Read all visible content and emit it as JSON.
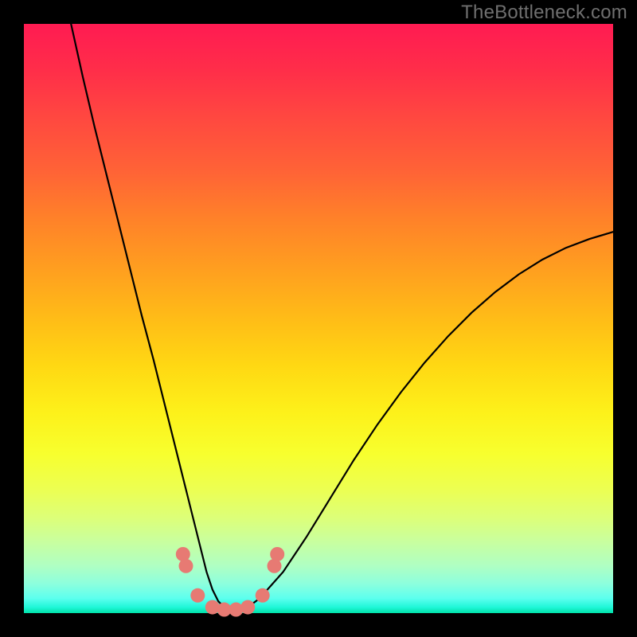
{
  "watermark": "TheBottleneck.com",
  "colors": {
    "frame": "#000000",
    "curve": "#000000",
    "marker_fill": "#e77a73",
    "marker_stroke": "#b94f4a"
  },
  "chart_data": {
    "type": "line",
    "title": "",
    "xlabel": "",
    "ylabel": "",
    "xlim": [
      0,
      100
    ],
    "ylim": [
      0,
      100
    ],
    "grid": false,
    "legend": false,
    "series": [
      {
        "name": "bottleneck-curve",
        "x": [
          8,
          10,
          12,
          14,
          16,
          18,
          20,
          22,
          24,
          26,
          27,
          28,
          29,
          30,
          31,
          32,
          33,
          34,
          35,
          36,
          38,
          40,
          44,
          48,
          52,
          56,
          60,
          64,
          68,
          72,
          76,
          80,
          84,
          88,
          92,
          96,
          100
        ],
        "y": [
          100,
          91,
          82.5,
          74.5,
          66.5,
          58.5,
          50.5,
          43,
          35,
          27,
          23,
          19,
          15,
          11,
          7,
          4,
          2,
          1,
          0.5,
          0.5,
          1,
          2.5,
          7,
          13,
          19.5,
          26,
          32,
          37.5,
          42.5,
          47,
          51,
          54.5,
          57.5,
          60,
          62,
          63.5,
          64.7
        ]
      }
    ],
    "markers": [
      {
        "x": 27.0,
        "y": 10.0
      },
      {
        "x": 27.5,
        "y": 8.0
      },
      {
        "x": 29.5,
        "y": 3.0
      },
      {
        "x": 32.0,
        "y": 1.0
      },
      {
        "x": 34.0,
        "y": 0.6
      },
      {
        "x": 36.0,
        "y": 0.6
      },
      {
        "x": 38.0,
        "y": 1.0
      },
      {
        "x": 40.5,
        "y": 3.0
      },
      {
        "x": 42.5,
        "y": 8.0
      },
      {
        "x": 43.0,
        "y": 10.0
      }
    ],
    "marker_radius_px": 9
  }
}
